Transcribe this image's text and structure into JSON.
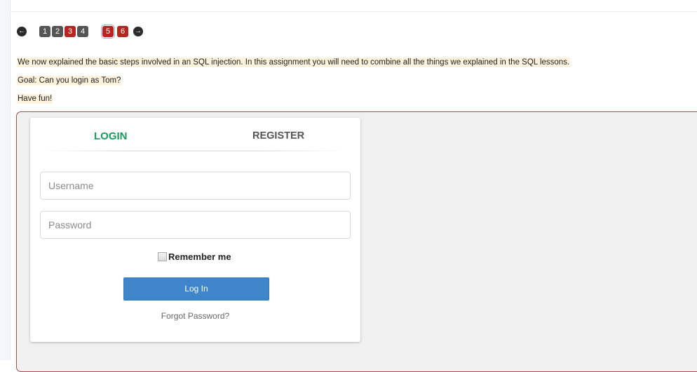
{
  "pager": {
    "prev_icon": "arrow-left-circle-icon",
    "next_icon": "arrow-right-circle-icon",
    "pages": [
      {
        "label": "1",
        "state": "normal"
      },
      {
        "label": "2",
        "state": "normal"
      },
      {
        "label": "3",
        "state": "red"
      },
      {
        "label": "4",
        "state": "normal"
      },
      {
        "label": "5",
        "state": "current"
      },
      {
        "label": "6",
        "state": "red"
      }
    ]
  },
  "intro": {
    "line1": "We now explained the basic steps involved in an SQL injection. In this assignment you will need to combine all the things we explained in the SQL lessons.",
    "line2": "Goal: Can you login as Tom?",
    "line3": "Have fun!"
  },
  "form": {
    "tab_login": "LOGIN",
    "tab_register": "REGISTER",
    "username_placeholder": "Username",
    "password_placeholder": "Password",
    "remember_label": "Remember me",
    "login_button": "Log In",
    "forgot_link": "Forgot Password?"
  },
  "colors": {
    "accent_green": "#1a9a5c",
    "button_blue": "#3e86c9",
    "page_red": "#b52620",
    "frame_border": "#a94a4a",
    "highlight": "#fdf2dc"
  }
}
